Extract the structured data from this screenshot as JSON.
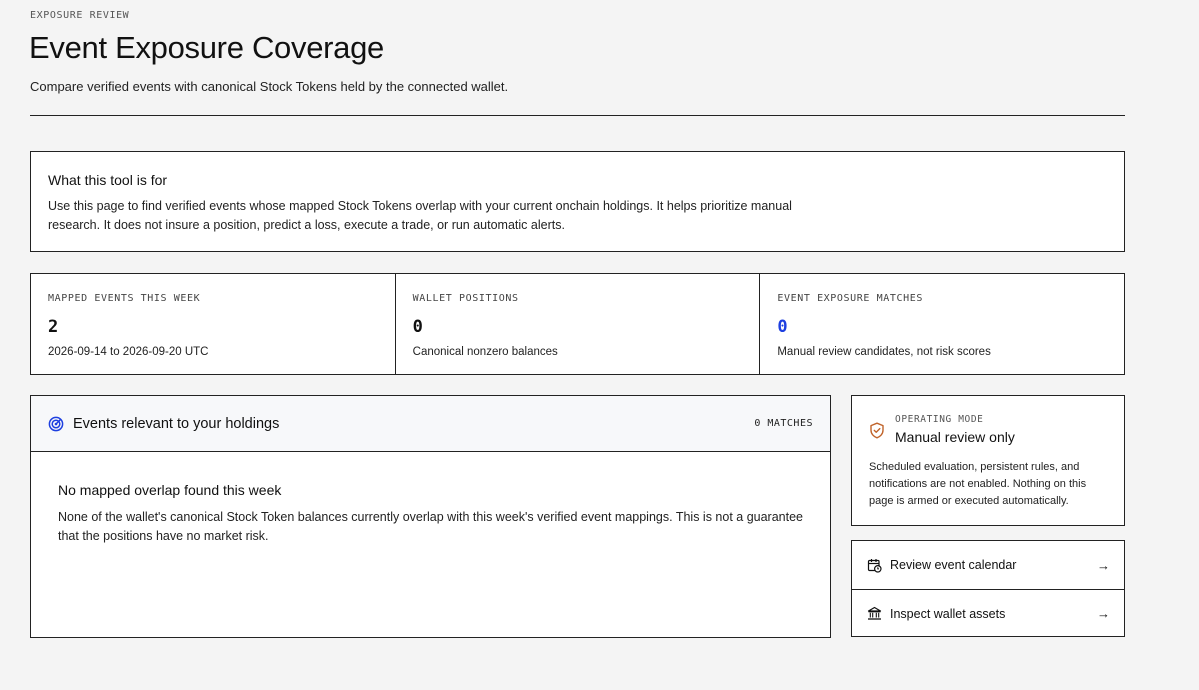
{
  "header": {
    "eyebrow": "EXPOSURE REVIEW",
    "title": "Event Exposure Coverage",
    "subtitle": "Compare verified events with canonical Stock Tokens held by the connected wallet."
  },
  "info": {
    "title": "What this tool is for",
    "body": "Use this page to find verified events whose mapped Stock Tokens overlap with your current onchain holdings. It helps prioritize manual research. It does not insure a position, predict a loss, execute a trade, or run automatic alerts."
  },
  "stats": [
    {
      "label": "MAPPED EVENTS THIS WEEK",
      "value": "2",
      "note": "2026-09-14 to 2026-09-20 UTC"
    },
    {
      "label": "WALLET POSITIONS",
      "value": "0",
      "note": "Canonical nonzero balances"
    },
    {
      "label": "EVENT EXPOSURE MATCHES",
      "value": "0",
      "note": "Manual review candidates, not risk scores"
    }
  ],
  "events": {
    "title": "Events relevant to your holdings",
    "count": "0 MATCHES",
    "icon": "radar-icon",
    "empty_title": "No mapped overlap found this week",
    "empty_body": "None of the wallet's canonical Stock Token balances currently overlap with this week's verified event mappings. This is not a guarantee that the positions have no market risk."
  },
  "mode": {
    "label": "OPERATING MODE",
    "title": "Manual review only",
    "icon": "shield-check-icon",
    "body": "Scheduled evaluation, persistent rules, and notifications are not enabled. Nothing on this page is armed or executed automatically."
  },
  "links": [
    {
      "label": "Review event calendar",
      "icon": "calendar-icon",
      "arrow": "→"
    },
    {
      "label": "Inspect wallet assets",
      "icon": "bank-icon",
      "arrow": "→"
    }
  ],
  "colors": {
    "accent": "#1d3fe0",
    "warning": "#c0632a"
  }
}
